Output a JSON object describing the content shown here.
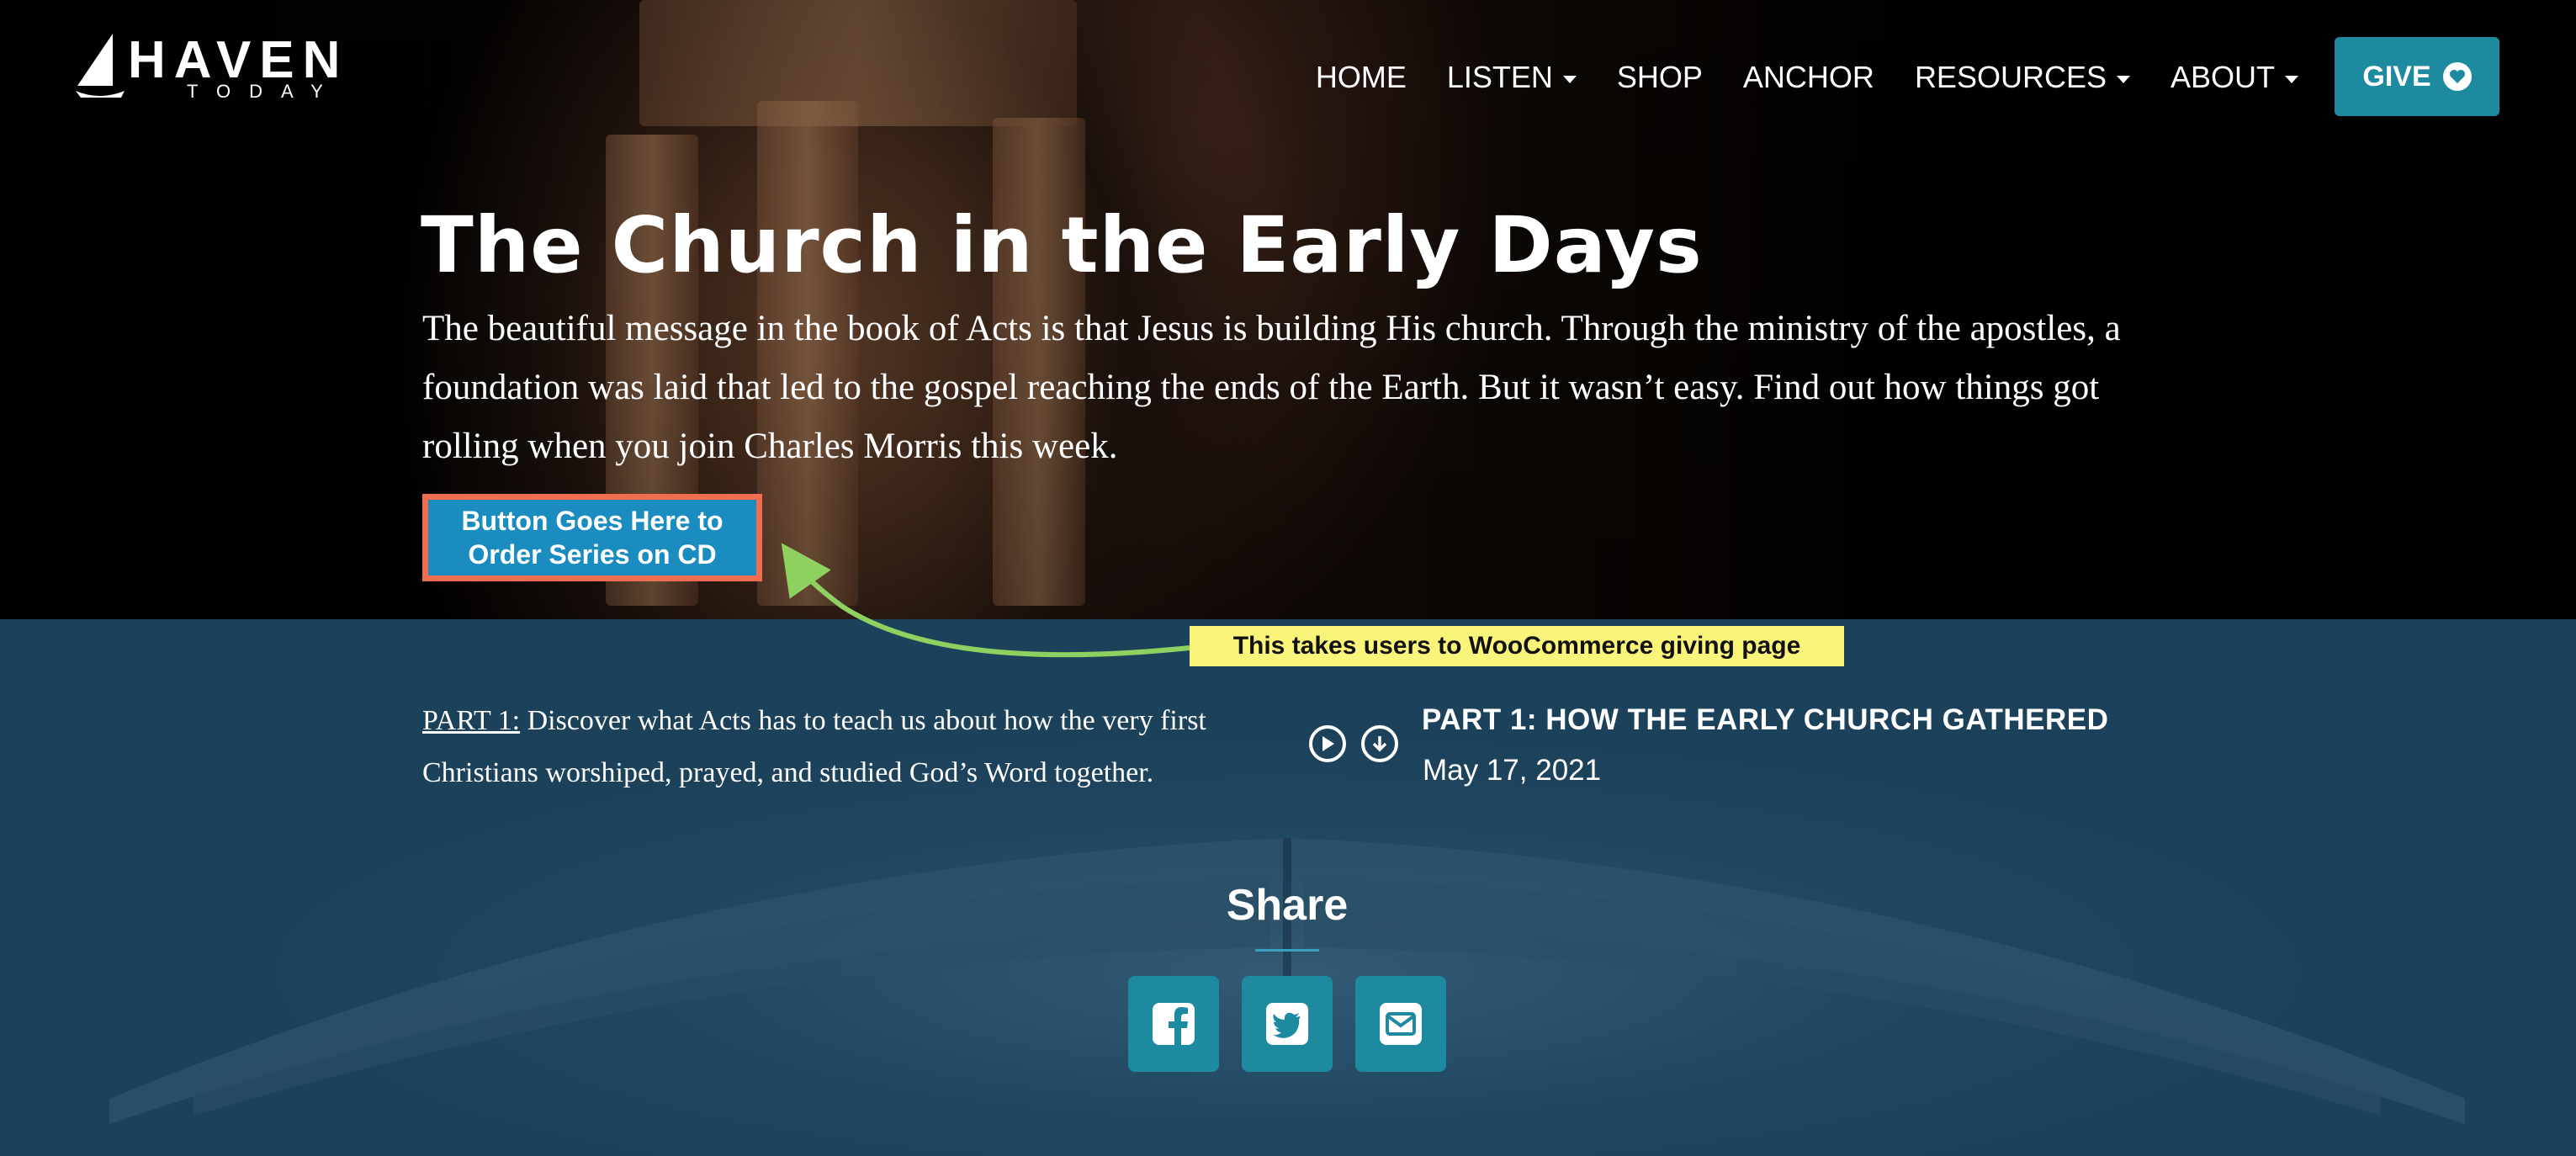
{
  "brand": {
    "name": "HAVEN",
    "tagline": "TODAY"
  },
  "nav": {
    "items": [
      {
        "label": "HOME",
        "dropdown": false
      },
      {
        "label": "LISTEN",
        "dropdown": true
      },
      {
        "label": "SHOP",
        "dropdown": false
      },
      {
        "label": "ANCHOR",
        "dropdown": false
      },
      {
        "label": "RESOURCES",
        "dropdown": true
      },
      {
        "label": "ABOUT",
        "dropdown": true
      }
    ],
    "give_label": "GIVE"
  },
  "hero": {
    "title": "The Church in the Early Days",
    "description": "The beautiful message in the book of Acts is that Jesus is building His church. Through the ministry of the apostles, a foundation was laid that led to the gospel reaching the ends of the Earth. But it wasn’t easy. Find out how things got rolling when you join Charles Morris this week.",
    "order_button_line1": "Button Goes Here to",
    "order_button_line2": "Order Series on CD"
  },
  "annotation": {
    "text": "This takes users to WooCommerce giving page"
  },
  "episode": {
    "part_link": "PART 1:",
    "summary": " Discover what Acts has to teach us about how the very first Christians worshiped, prayed, and studied God’s Word together.",
    "title": "PART 1: HOW THE EARLY CHURCH GATHERED",
    "date": "May 17, 2021"
  },
  "share": {
    "title": "Share",
    "buttons": [
      "facebook-icon",
      "twitter-icon",
      "email-icon"
    ]
  },
  "colors": {
    "accent": "#1e8aa0",
    "order_button": "#1a8cbf",
    "order_border": "#f06d4f",
    "annotation_bg": "#fbf47a",
    "arrow": "#8fd160"
  }
}
